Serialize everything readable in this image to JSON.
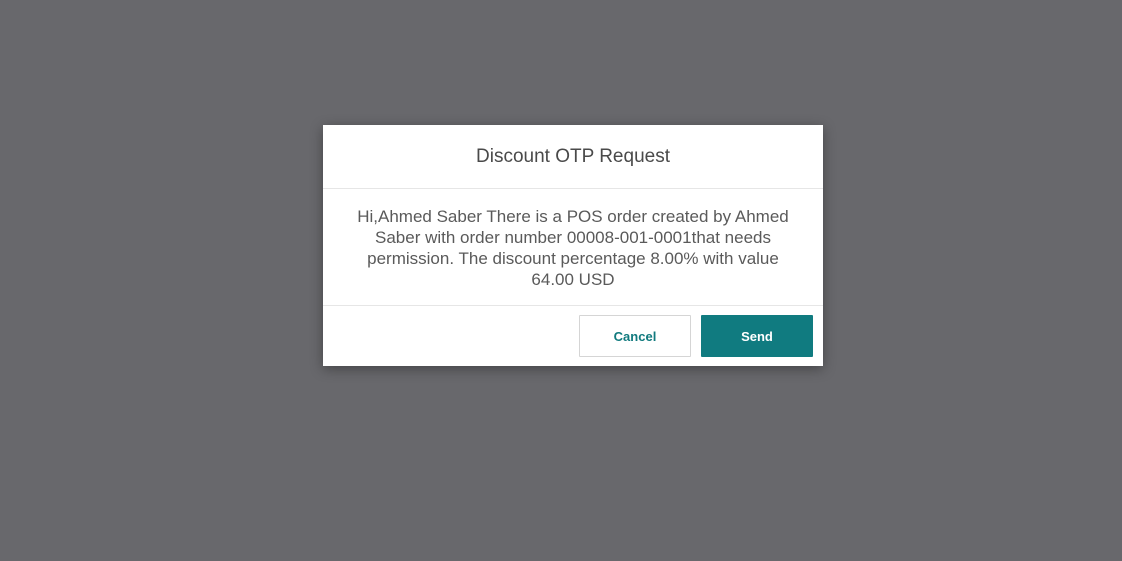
{
  "dialog": {
    "title": "Discount OTP Request",
    "message": "Hi,Ahmed Saber There is a POS order created by Ahmed Saber with order number 00008-001-0001that needs permission. The discount percentage 8.00% with value 64.00 USD",
    "cancel_label": "Cancel",
    "send_label": "Send"
  },
  "colors": {
    "backdrop": "#68686c",
    "accent": "#107b80"
  }
}
